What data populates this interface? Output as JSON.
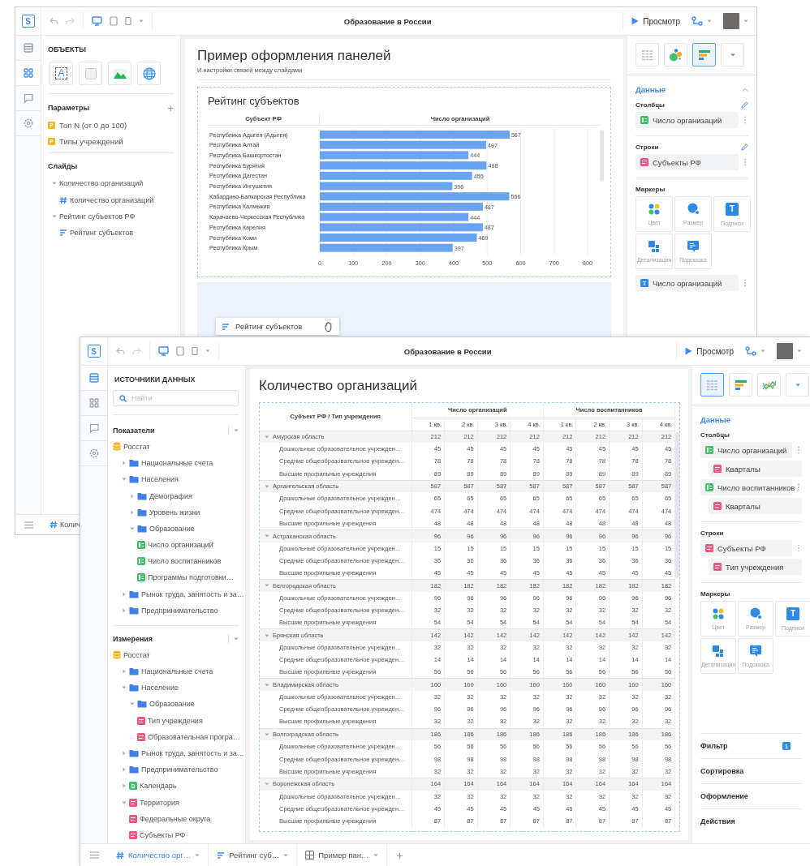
{
  "back_window": {
    "toolbar": {
      "logo": "S",
      "title": "Образование в России",
      "preview_button": "Просмотр",
      "devices": [
        {
          "kind": "desktop",
          "selected": true
        },
        {
          "kind": "tablet",
          "selected": false
        },
        {
          "kind": "phone",
          "selected": false
        }
      ]
    },
    "rail": [
      {
        "kind": "list",
        "selected": false
      },
      {
        "kind": "grid",
        "selected": true
      },
      {
        "kind": "comment",
        "selected": false
      },
      {
        "kind": "settings",
        "selected": false
      }
    ],
    "objects_panel": {
      "title": "ОБЪЕКТЫ",
      "objects": [
        {
          "kind": "text",
          "glyph": "A"
        },
        {
          "kind": "shape"
        },
        {
          "kind": "image"
        },
        {
          "kind": "web"
        }
      ],
      "parameters": {
        "title": "Параметры",
        "add": "+",
        "items": [
          {
            "badge": "P",
            "label": "Топ N (от 0 до 100)"
          },
          {
            "badge": "P",
            "label": "Типы учреждений"
          }
        ]
      },
      "slides": {
        "title": "Слайды",
        "items": [
          {
            "label": "Количество организаций",
            "expanded": true,
            "children": [
              {
                "label": "Количество организаций",
                "kind": "number"
              }
            ]
          },
          {
            "label": "Рейтинг субъектов РФ",
            "expanded": true,
            "children": [
              {
                "label": "Рейтинг субъектов",
                "kind": "bar"
              }
            ]
          }
        ]
      }
    },
    "canvas": {
      "title": "Пример оформления панелей",
      "subtitle": "И настройки связей между слайдами",
      "panel": {
        "title": "Рейтинг субъектов",
        "headers": [
          "Субъект РФ"
        ],
        "chart_data": {
          "type": "bar",
          "orientation": "horizontal",
          "categories": [
            "Республика Адыгея (Адыгея)",
            "Республика Алтай",
            "Республика Башкортостан",
            "Республика Бурятия",
            "Республика Дагестан",
            "Республика Ингушетия",
            "Кабардино-Балкарская Республика",
            "Республика Калмыкия",
            "Карачаево-Черкесская Республика",
            "Республика Карелия",
            "Республика Коми",
            "Республика Крым"
          ],
          "series": [
            {
              "name": "Число организаций",
              "color": "#6aa3ef",
              "values": [
                567,
                497,
                444,
                498,
                455,
                396,
                566,
                487,
                444,
                487,
                469,
                397
              ]
            }
          ],
          "xlim": [
            0,
            800
          ],
          "xticks": [
            0,
            100,
            200,
            300,
            400,
            500,
            600,
            700,
            800
          ],
          "grid": true,
          "data_labels": true
        }
      },
      "drag_chip": {
        "label": "Рейтинг субъектов"
      }
    },
    "settings_panel": {
      "chart_types": [
        {
          "kind": "table",
          "selected": false
        },
        {
          "kind": "bubble",
          "selected": false
        },
        {
          "kind": "bar",
          "selected": true
        },
        {
          "kind": "more",
          "selected": false
        }
      ],
      "section": "Данные",
      "columns": {
        "title": "Столбцы",
        "fields": [
          {
            "label": "Число организаций",
            "kind": "measure"
          }
        ]
      },
      "rows": {
        "title": "Строки",
        "fields": [
          {
            "label": "Субъекты РФ",
            "kind": "dimension"
          }
        ]
      },
      "markers": {
        "title": "Маркеры",
        "items": [
          {
            "kind": "color",
            "label": "Цвет"
          },
          {
            "kind": "size",
            "label": "Размер"
          },
          {
            "kind": "label",
            "label": "Подписи",
            "glyph": "T"
          },
          {
            "kind": "detail",
            "label": "Детализация"
          },
          {
            "kind": "tooltip",
            "label": "Подсказка"
          }
        ],
        "fields": [
          {
            "label": "Число организаций",
            "badge": "T"
          }
        ]
      }
    },
    "bottom_tabs": [
      {
        "label": "Колич",
        "kind": "number",
        "selected": false
      }
    ]
  },
  "front_window": {
    "toolbar": {
      "logo": "S",
      "title": "Образование в России",
      "preview_button": "Просмотр",
      "devices": [
        {
          "kind": "desktop",
          "selected": true
        },
        {
          "kind": "tablet",
          "selected": false
        },
        {
          "kind": "phone",
          "selected": false
        }
      ]
    },
    "rail": [
      {
        "kind": "list",
        "selected": true
      },
      {
        "kind": "grid",
        "selected": false
      },
      {
        "kind": "comment",
        "selected": false
      },
      {
        "kind": "settings",
        "selected": false
      }
    ],
    "data_panel": {
      "title": "ИСТОЧНИКИ ДАННЫХ",
      "search": {
        "placeholder": "Найти"
      },
      "indicators": {
        "title": "Показатели",
        "items": [
          {
            "label": "Росстат",
            "kind": "source",
            "children": [
              {
                "label": "Национальные счета",
                "kind": "folder",
                "expanded": false
              },
              {
                "label": "Населения",
                "kind": "folder",
                "expanded": true,
                "children": [
                  {
                    "label": "Демография",
                    "kind": "folder",
                    "expanded": false
                  },
                  {
                    "label": "Уровень жизни",
                    "kind": "folder",
                    "expanded": false
                  },
                  {
                    "label": "Образование",
                    "kind": "folder",
                    "expanded": true,
                    "children": [
                      {
                        "label": "Число организаций",
                        "kind": "measure"
                      },
                      {
                        "label": "Число воспитанников",
                        "kind": "measure"
                      },
                      {
                        "label": "Программы подготовки…",
                        "kind": "measure"
                      }
                    ]
                  }
                ]
              },
              {
                "label": "Рынок труда, занятость и за…",
                "kind": "folder",
                "expanded": false
              },
              {
                "label": "Предпринимательство",
                "kind": "folder",
                "expanded": false
              }
            ]
          }
        ]
      },
      "dimensions": {
        "title": "Измерения",
        "items": [
          {
            "label": "Росстат",
            "kind": "source",
            "children": [
              {
                "label": "Национальные счета",
                "kind": "folder",
                "expanded": false
              },
              {
                "label": "Население",
                "kind": "folder",
                "expanded": true,
                "children": [
                  {
                    "label": "Образование",
                    "kind": "folder",
                    "expanded": true,
                    "children": [
                      {
                        "label": "Тип учреждения",
                        "kind": "dimension"
                      },
                      {
                        "label": "Образовательная програ…",
                        "kind": "dimension"
                      }
                    ]
                  }
                ]
              },
              {
                "label": "Рынок труда, занятость и за…",
                "kind": "folder",
                "expanded": false
              },
              {
                "label": "Предпринимательство",
                "kind": "folder",
                "expanded": false
              },
              {
                "label": "Календарь",
                "kind": "date",
                "badge": "D",
                "expanded": false
              },
              {
                "label": "Территория",
                "kind": "dimension",
                "expanded": true,
                "children": [
                  {
                    "label": "Федеральные округа",
                    "kind": "dimension"
                  },
                  {
                    "label": "Субъекты РФ",
                    "kind": "dimension"
                  }
                ]
              }
            ]
          }
        ]
      }
    },
    "canvas": {
      "title": "Количество организаций",
      "table": {
        "corner": "Субъект РФ / Тип учреждения",
        "column_groups": [
          {
            "label": "Число организаций",
            "columns": [
              "1 кв.",
              "2 кв.",
              "3 кв.",
              "4 кв."
            ]
          },
          {
            "label": "Число воспитанников",
            "columns": [
              "1 кв.",
              "2 кв.",
              "3 кв.",
              "4 кв."
            ]
          }
        ],
        "rows": [
          {
            "label": "Амурская область",
            "expanded": true,
            "values": [
              "212",
              "212",
              "212",
              "212",
              "212",
              "212",
              "212",
              "212"
            ],
            "children": [
              {
                "label": "Дошкольные образовательное учрежден…",
                "values": [
                  "45",
                  "45",
                  "45",
                  "45",
                  "45",
                  "45",
                  "45",
                  "45"
                ]
              },
              {
                "label": "Средние общеобразовательное учрежден…",
                "values": [
                  "78",
                  "78",
                  "78",
                  "78",
                  "78",
                  "78",
                  "78",
                  "78"
                ]
              },
              {
                "label": "Высшие профильные учреждения",
                "values": [
                  "89",
                  "89",
                  "89",
                  "89",
                  "89",
                  "89",
                  "89",
                  "89"
                ]
              }
            ]
          },
          {
            "label": "Архангельская область",
            "expanded": true,
            "values": [
              "587",
              "587",
              "587",
              "587",
              "587",
              "587",
              "587",
              "587"
            ],
            "children": [
              {
                "label": "Дошкольные образовательное учрежден…",
                "values": [
                  "65",
                  "65",
                  "65",
                  "65",
                  "65",
                  "65",
                  "65",
                  "65"
                ]
              },
              {
                "label": "Средние общеобразовательное учрежден…",
                "values": [
                  "474",
                  "474",
                  "474",
                  "474",
                  "474",
                  "474",
                  "474",
                  "474"
                ]
              },
              {
                "label": "Высшие профильные учреждения",
                "values": [
                  "48",
                  "48",
                  "48",
                  "48",
                  "48",
                  "48",
                  "48",
                  "48"
                ]
              }
            ]
          },
          {
            "label": "Астраханская область",
            "expanded": true,
            "values": [
              "96",
              "96",
              "96",
              "96",
              "96",
              "96",
              "96",
              "96"
            ],
            "children": [
              {
                "label": "Дошкольные образовательное учрежден…",
                "values": [
                  "15",
                  "15",
                  "15",
                  "15",
                  "15",
                  "15",
                  "15",
                  "15"
                ]
              },
              {
                "label": "Средние общеобразовательное учрежден…",
                "values": [
                  "36",
                  "36",
                  "36",
                  "36",
                  "36",
                  "36",
                  "36",
                  "36"
                ]
              },
              {
                "label": "Высшие профильные учреждения",
                "values": [
                  "45",
                  "45",
                  "45",
                  "45",
                  "45",
                  "45",
                  "45",
                  "45"
                ]
              }
            ]
          },
          {
            "label": "Белгородская область",
            "expanded": true,
            "values": [
              "182",
              "182",
              "182",
              "182",
              "182",
              "182",
              "182",
              "182"
            ],
            "children": [
              {
                "label": "Дошкольные образовательное учрежден…",
                "values": [
                  "96",
                  "96",
                  "96",
                  "96",
                  "96",
                  "96",
                  "96",
                  "96"
                ]
              },
              {
                "label": "Средние общеобразовательное учрежден…",
                "values": [
                  "32",
                  "32",
                  "32",
                  "32",
                  "32",
                  "32",
                  "32",
                  "32"
                ]
              },
              {
                "label": "Высшие профильные учреждения",
                "values": [
                  "54",
                  "54",
                  "54",
                  "54",
                  "54",
                  "54",
                  "54",
                  "54"
                ]
              }
            ]
          },
          {
            "label": "Брянская область",
            "expanded": true,
            "values": [
              "142",
              "142",
              "142",
              "142",
              "142",
              "142",
              "142",
              "142"
            ],
            "children": [
              {
                "label": "Дошкольные образовательное учрежден…",
                "values": [
                  "32",
                  "32",
                  "32",
                  "32",
                  "32",
                  "32",
                  "32",
                  "32"
                ]
              },
              {
                "label": "Средние общеобразовательное учрежден…",
                "values": [
                  "14",
                  "14",
                  "14",
                  "14",
                  "14",
                  "14",
                  "14",
                  "14"
                ]
              },
              {
                "label": "Высшие профильные учреждения",
                "values": [
                  "56",
                  "56",
                  "56",
                  "56",
                  "56",
                  "56",
                  "56",
                  "56"
                ]
              }
            ]
          },
          {
            "label": "Владимирская область",
            "expanded": true,
            "values": [
              "160",
              "160",
              "160",
              "160",
              "160",
              "160",
              "160",
              "160"
            ],
            "children": [
              {
                "label": "Дошкольные образовательное учрежден…",
                "values": [
                  "32",
                  "32",
                  "32",
                  "32",
                  "32",
                  "32",
                  "32",
                  "32"
                ]
              },
              {
                "label": "Средние общеобразовательное учрежден…",
                "values": [
                  "96",
                  "96",
                  "96",
                  "96",
                  "96",
                  "96",
                  "96",
                  "96"
                ]
              },
              {
                "label": "Высшие профильные учреждения",
                "values": [
                  "32",
                  "32",
                  "32",
                  "32",
                  "32",
                  "32",
                  "32",
                  "32"
                ]
              }
            ]
          },
          {
            "label": "Волгоградская область",
            "expanded": true,
            "values": [
              "186",
              "186",
              "186",
              "186",
              "186",
              "186",
              "186",
              "186"
            ],
            "children": [
              {
                "label": "Дошкольные образовательное учрежден…",
                "values": [
                  "56",
                  "56",
                  "56",
                  "56",
                  "56",
                  "56",
                  "56",
                  "56"
                ]
              },
              {
                "label": "Средние общеобразовательное учрежден…",
                "values": [
                  "98",
                  "98",
                  "98",
                  "98",
                  "98",
                  "98",
                  "98",
                  "98"
                ]
              },
              {
                "label": "Высшие профильные учреждения",
                "values": [
                  "32",
                  "32",
                  "32",
                  "32",
                  "32",
                  "32",
                  "32",
                  "32"
                ]
              }
            ]
          },
          {
            "label": "Воронежская область",
            "expanded": true,
            "values": [
              "164",
              "164",
              "164",
              "164",
              "164",
              "164",
              "164",
              "164"
            ],
            "children": [
              {
                "label": "Дошкольные образовательное учрежден…",
                "values": [
                  "32",
                  "32",
                  "32",
                  "32",
                  "32",
                  "32",
                  "32",
                  "32"
                ]
              },
              {
                "label": "Средние общеобразовательное учрежден…",
                "values": [
                  "45",
                  "45",
                  "45",
                  "45",
                  "45",
                  "45",
                  "45",
                  "45"
                ]
              },
              {
                "label": "Высшие профильные учреждения",
                "values": [
                  "87",
                  "87",
                  "87",
                  "87",
                  "87",
                  "87",
                  "87",
                  "87"
                ]
              }
            ]
          }
        ]
      }
    },
    "settings_panel": {
      "chart_types": [
        {
          "kind": "table",
          "selected": true
        },
        {
          "kind": "bar",
          "selected": false
        },
        {
          "kind": "line",
          "selected": false
        },
        {
          "kind": "more",
          "selected": false
        }
      ],
      "section": "Данные",
      "columns": {
        "title": "Столбцы",
        "fields": [
          {
            "label": "Число организаций",
            "kind": "measure",
            "children": [
              {
                "label": "Кварталы",
                "kind": "dimension"
              }
            ]
          },
          {
            "label": "Число воспитанников",
            "kind": "measure",
            "children": [
              {
                "label": "Кварталы",
                "kind": "dimension"
              }
            ]
          }
        ]
      },
      "rows": {
        "title": "Строки",
        "fields": [
          {
            "label": "Субъекты РФ",
            "kind": "dimension",
            "children": [
              {
                "label": "Тип учреждения",
                "kind": "dimension"
              }
            ]
          }
        ]
      },
      "markers": {
        "title": "Маркеры",
        "items": [
          {
            "kind": "color",
            "label": "Цвет"
          },
          {
            "kind": "size",
            "label": "Размер"
          },
          {
            "kind": "label",
            "label": "Подписи",
            "glyph": "T"
          },
          {
            "kind": "detail",
            "label": "Детализация"
          },
          {
            "kind": "tooltip",
            "label": "Подсказка"
          }
        ]
      },
      "sections": [
        {
          "label": "Фильтр",
          "badge": "1"
        },
        {
          "label": "Сортировка"
        },
        {
          "label": "Оформление"
        },
        {
          "label": "Действия"
        }
      ]
    },
    "bottom_tabs": [
      {
        "label": "Количество орг…",
        "kind": "number",
        "selected": true
      },
      {
        "label": "Рейтинг суб…",
        "kind": "bar",
        "selected": false
      },
      {
        "label": "Пример пан…",
        "kind": "layout",
        "selected": false
      }
    ],
    "add_tab": "+"
  }
}
